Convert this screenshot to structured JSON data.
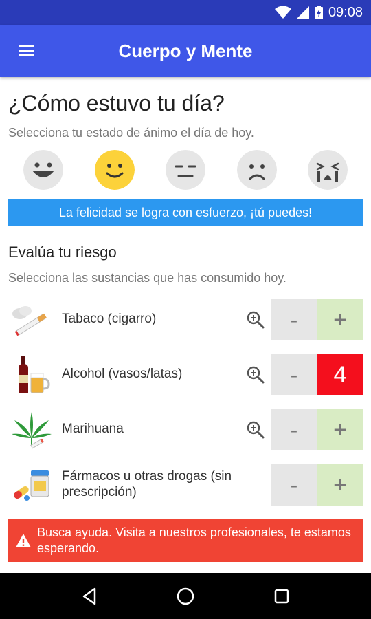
{
  "status_bar": {
    "time": "09:08",
    "icons": [
      "wifi-icon",
      "signal-icon",
      "battery-icon"
    ]
  },
  "toolbar": {
    "title": "Cuerpo y Mente",
    "menu_icon": "hamburger-menu-icon"
  },
  "mood_section": {
    "title": "¿Cómo estuvo tu día?",
    "subtitle": "Selecciona tu estado de ánimo el día de hoy.",
    "moods": [
      "very-happy",
      "happy",
      "neutral",
      "sad",
      "crying"
    ],
    "selected": "happy",
    "message": "La felicidad se logra con esfuerzo, ¡tú puedes!"
  },
  "risk_section": {
    "title": "Evalúa tu riesgo",
    "subtitle": "Selecciona las sustancias que has consumido hoy.",
    "items": [
      {
        "label": "Tabaco (cigarro)",
        "icon": "cigarette-icon",
        "minus": "-",
        "plus": "+",
        "count": null
      },
      {
        "label": "Alcohol (vasos/latas)",
        "icon": "alcohol-icon",
        "minus": "-",
        "plus": "4",
        "count": 4
      },
      {
        "label": "Marihuana",
        "icon": "cannabis-leaf-icon",
        "minus": "-",
        "plus": "+",
        "count": null
      },
      {
        "label": "Fármacos u otras drogas (sin prescripción)",
        "icon": "pills-icon",
        "minus": "-",
        "plus": "+",
        "count": null
      }
    ],
    "warning": "Busca ayuda. Visita a nuestros profesionales, te estamos esperando."
  },
  "colors": {
    "toolbar": "#3f57e8",
    "status_bar": "#2a3bb8",
    "info_banner": "#2c98f0",
    "warning_banner": "#f04434",
    "selected_mood": "#fcd23a",
    "count_active": "#f40f1d",
    "plus_bg": "#d9ecc4"
  }
}
